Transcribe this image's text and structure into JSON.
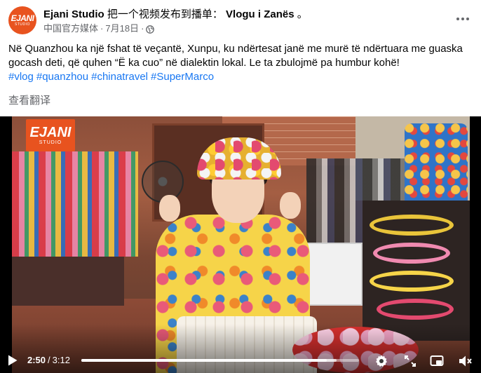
{
  "post": {
    "page_name": "Ejani Studio",
    "share_text": "把一个视频发布到播单：",
    "target_page": "Vlogu i Zanës",
    "share_suffix": " 。",
    "page_category": "中国官方媒体",
    "meta_separator": "·",
    "date": "7月18日",
    "meta_separator2": "·",
    "privacy_icon": "globe-icon",
    "more_icon": "more-options-icon",
    "avatar_text": "EJANI",
    "avatar_subtext": "STUDIO",
    "body_text": "Në Quanzhou ka një fshat të veçantë, Xunpu, ku ndërtesat janë me murë të ndërtuara me guaska gocash deti, që quhen “Ë ka cuo” në dialektin lokal.  Le ta zbulojmë pa humbur kohë!",
    "hashtags": [
      "#vlog",
      "#quanzhou",
      "#chinatravel",
      "#SuperMarco"
    ],
    "translate_label": "查看翻译"
  },
  "video": {
    "watermark_main": "EJANI",
    "watermark_sub": "STUDIO",
    "current_time": "2:50",
    "time_separator": "/",
    "duration": "3:12",
    "progress_fraction": 0.885,
    "buffered_fraction": 0.92,
    "controls": {
      "play_icon": "play-icon",
      "settings_icon": "settings-gear-icon",
      "fullscreen_icon": "expand-icon",
      "pip_icon": "picture-in-picture-icon",
      "volume_icon": "volume-muted-icon"
    }
  },
  "colors": {
    "link": "#1877f2",
    "secondary_text": "#65676b",
    "brand_orange": "#e8531f"
  }
}
